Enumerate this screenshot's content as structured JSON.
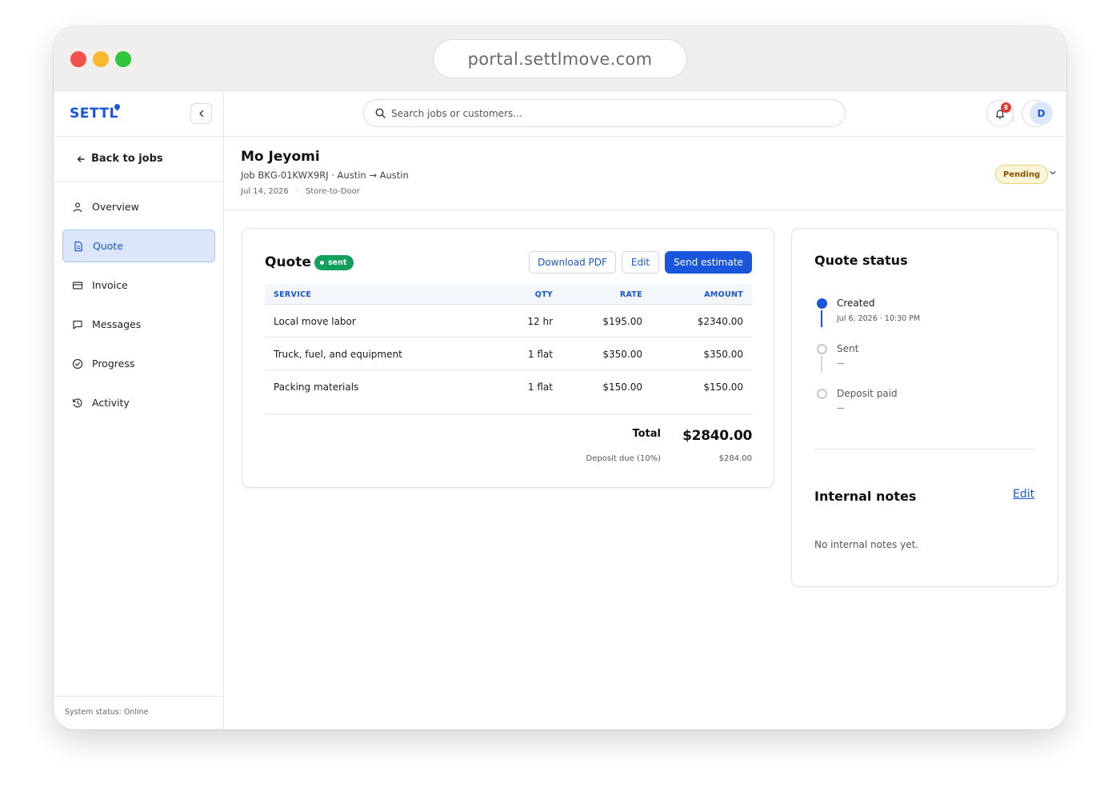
{
  "browser": {
    "url": "portal.settlmove.com"
  },
  "sidebar": {
    "brand": "SETTL",
    "back_label": "Back to jobs",
    "items": [
      {
        "label": "Overview",
        "icon": "user-icon",
        "active": false
      },
      {
        "label": "Quote",
        "icon": "document-icon",
        "active": true
      },
      {
        "label": "Invoice",
        "icon": "card-icon",
        "active": false
      },
      {
        "label": "Messages",
        "icon": "chat-icon",
        "active": false
      },
      {
        "label": "Progress",
        "icon": "check-circle-icon",
        "active": false
      },
      {
        "label": "Activity",
        "icon": "history-icon",
        "active": false
      }
    ],
    "system_status": "System status: Online"
  },
  "header": {
    "search_placeholder": "Search jobs or customers...",
    "notification_count": "8",
    "avatar_initial": "D"
  },
  "job": {
    "customer": "Mo Jeyomi",
    "job_line": "Job BKG-01KWX9RJ · Austin → Austin",
    "date": "Jul 14, 2026",
    "separator": "·",
    "service_type": "Store-to-Door",
    "status": "Pending"
  },
  "quote": {
    "title": "Quote",
    "status_chip": "sent",
    "buttons": {
      "download": "Download PDF",
      "edit": "Edit",
      "send": "Send estimate"
    },
    "columns": {
      "service": "SERVICE",
      "qty": "QTY",
      "rate": "RATE",
      "amount": "AMOUNT"
    },
    "rows": [
      {
        "service": "Local move labor",
        "qty": "12 hr",
        "rate": "$195.00",
        "amount": "$2340.00"
      },
      {
        "service": "Truck, fuel, and equipment",
        "qty": "1 flat",
        "rate": "$350.00",
        "amount": "$350.00"
      },
      {
        "service": "Packing materials",
        "qty": "1 flat",
        "rate": "$150.00",
        "amount": "$150.00"
      }
    ],
    "total_label": "Total",
    "total_value": "$2840.00",
    "deposit_label": "Deposit due (10%)",
    "deposit_value": "$284.00"
  },
  "quote_status": {
    "title": "Quote status",
    "steps": [
      {
        "label": "Created",
        "sub": "Jul 6, 2026 · 10:30 PM",
        "done": true
      },
      {
        "label": "Sent",
        "sub": "—",
        "done": false
      },
      {
        "label": "Deposit paid",
        "sub": "—",
        "done": false
      }
    ]
  },
  "notes": {
    "title": "Internal notes",
    "edit_label": "Edit",
    "empty_text": "No internal notes yet."
  },
  "colors": {
    "accent": "#1a56db",
    "sent": "#12a05c",
    "pending_bg": "#fdf5d8",
    "notification": "#e53935"
  }
}
